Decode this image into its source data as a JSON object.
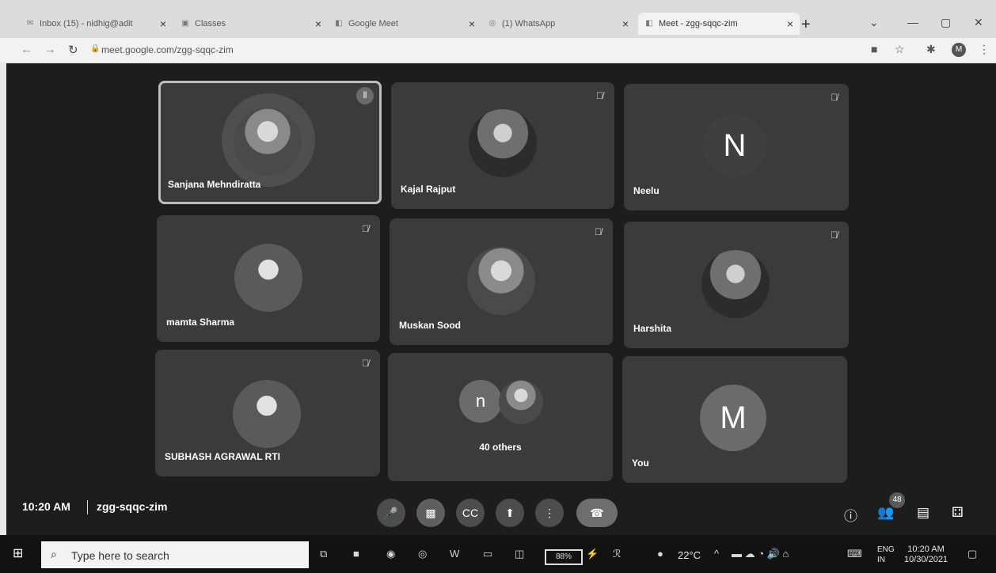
{
  "browser": {
    "tabs": [
      {
        "label": "Inbox (15) - nidhig@adit",
        "icon": "mail-icon",
        "active": false
      },
      {
        "label": "Classes",
        "icon": "classroom-icon",
        "active": false
      },
      {
        "label": "Google Meet",
        "icon": "meet-icon",
        "active": false
      },
      {
        "label": "(1) WhatsApp",
        "icon": "whatsapp-icon",
        "active": false
      },
      {
        "label": "Meet - zgg-sqqc-zim",
        "icon": "meet-icon",
        "active": true
      }
    ],
    "url": "meet.google.com/zgg-sqqc-zim",
    "profile_initial": "M"
  },
  "meet": {
    "participants": [
      {
        "name": "Sanjana Mehndiratta",
        "type": "photo",
        "muted": false,
        "speaking": true
      },
      {
        "name": "Kajal Rajput",
        "type": "photo",
        "muted": true
      },
      {
        "name": "Neelu",
        "type": "letter",
        "letter": "N",
        "muted": true
      },
      {
        "name": "mamta Sharma",
        "type": "photo",
        "muted": true
      },
      {
        "name": "Muskan Sood",
        "type": "photo",
        "muted": true
      },
      {
        "name": "Harshita",
        "type": "photo",
        "muted": true
      },
      {
        "name": "SUBHASH AGRAWAL RTI",
        "type": "photo",
        "muted": true
      },
      {
        "name": "40 others",
        "type": "group",
        "letter": "n"
      },
      {
        "name": "You",
        "type": "letter",
        "letter": "M",
        "muted": false
      }
    ],
    "time": "10:20 AM",
    "meeting_code": "zgg-sqqc-zim",
    "participant_count": "48"
  },
  "taskbar": {
    "search_placeholder": "Type here to search",
    "battery": "88%",
    "temperature": "22°C",
    "lang_top": "ENG",
    "lang_bottom": "IN",
    "time": "10:20 AM",
    "date": "10/30/2021"
  },
  "colors": {
    "meet_bg": "#1d1d1d",
    "tile_bg": "#3b3b3b",
    "tab_bar": "#dcdcdc"
  }
}
